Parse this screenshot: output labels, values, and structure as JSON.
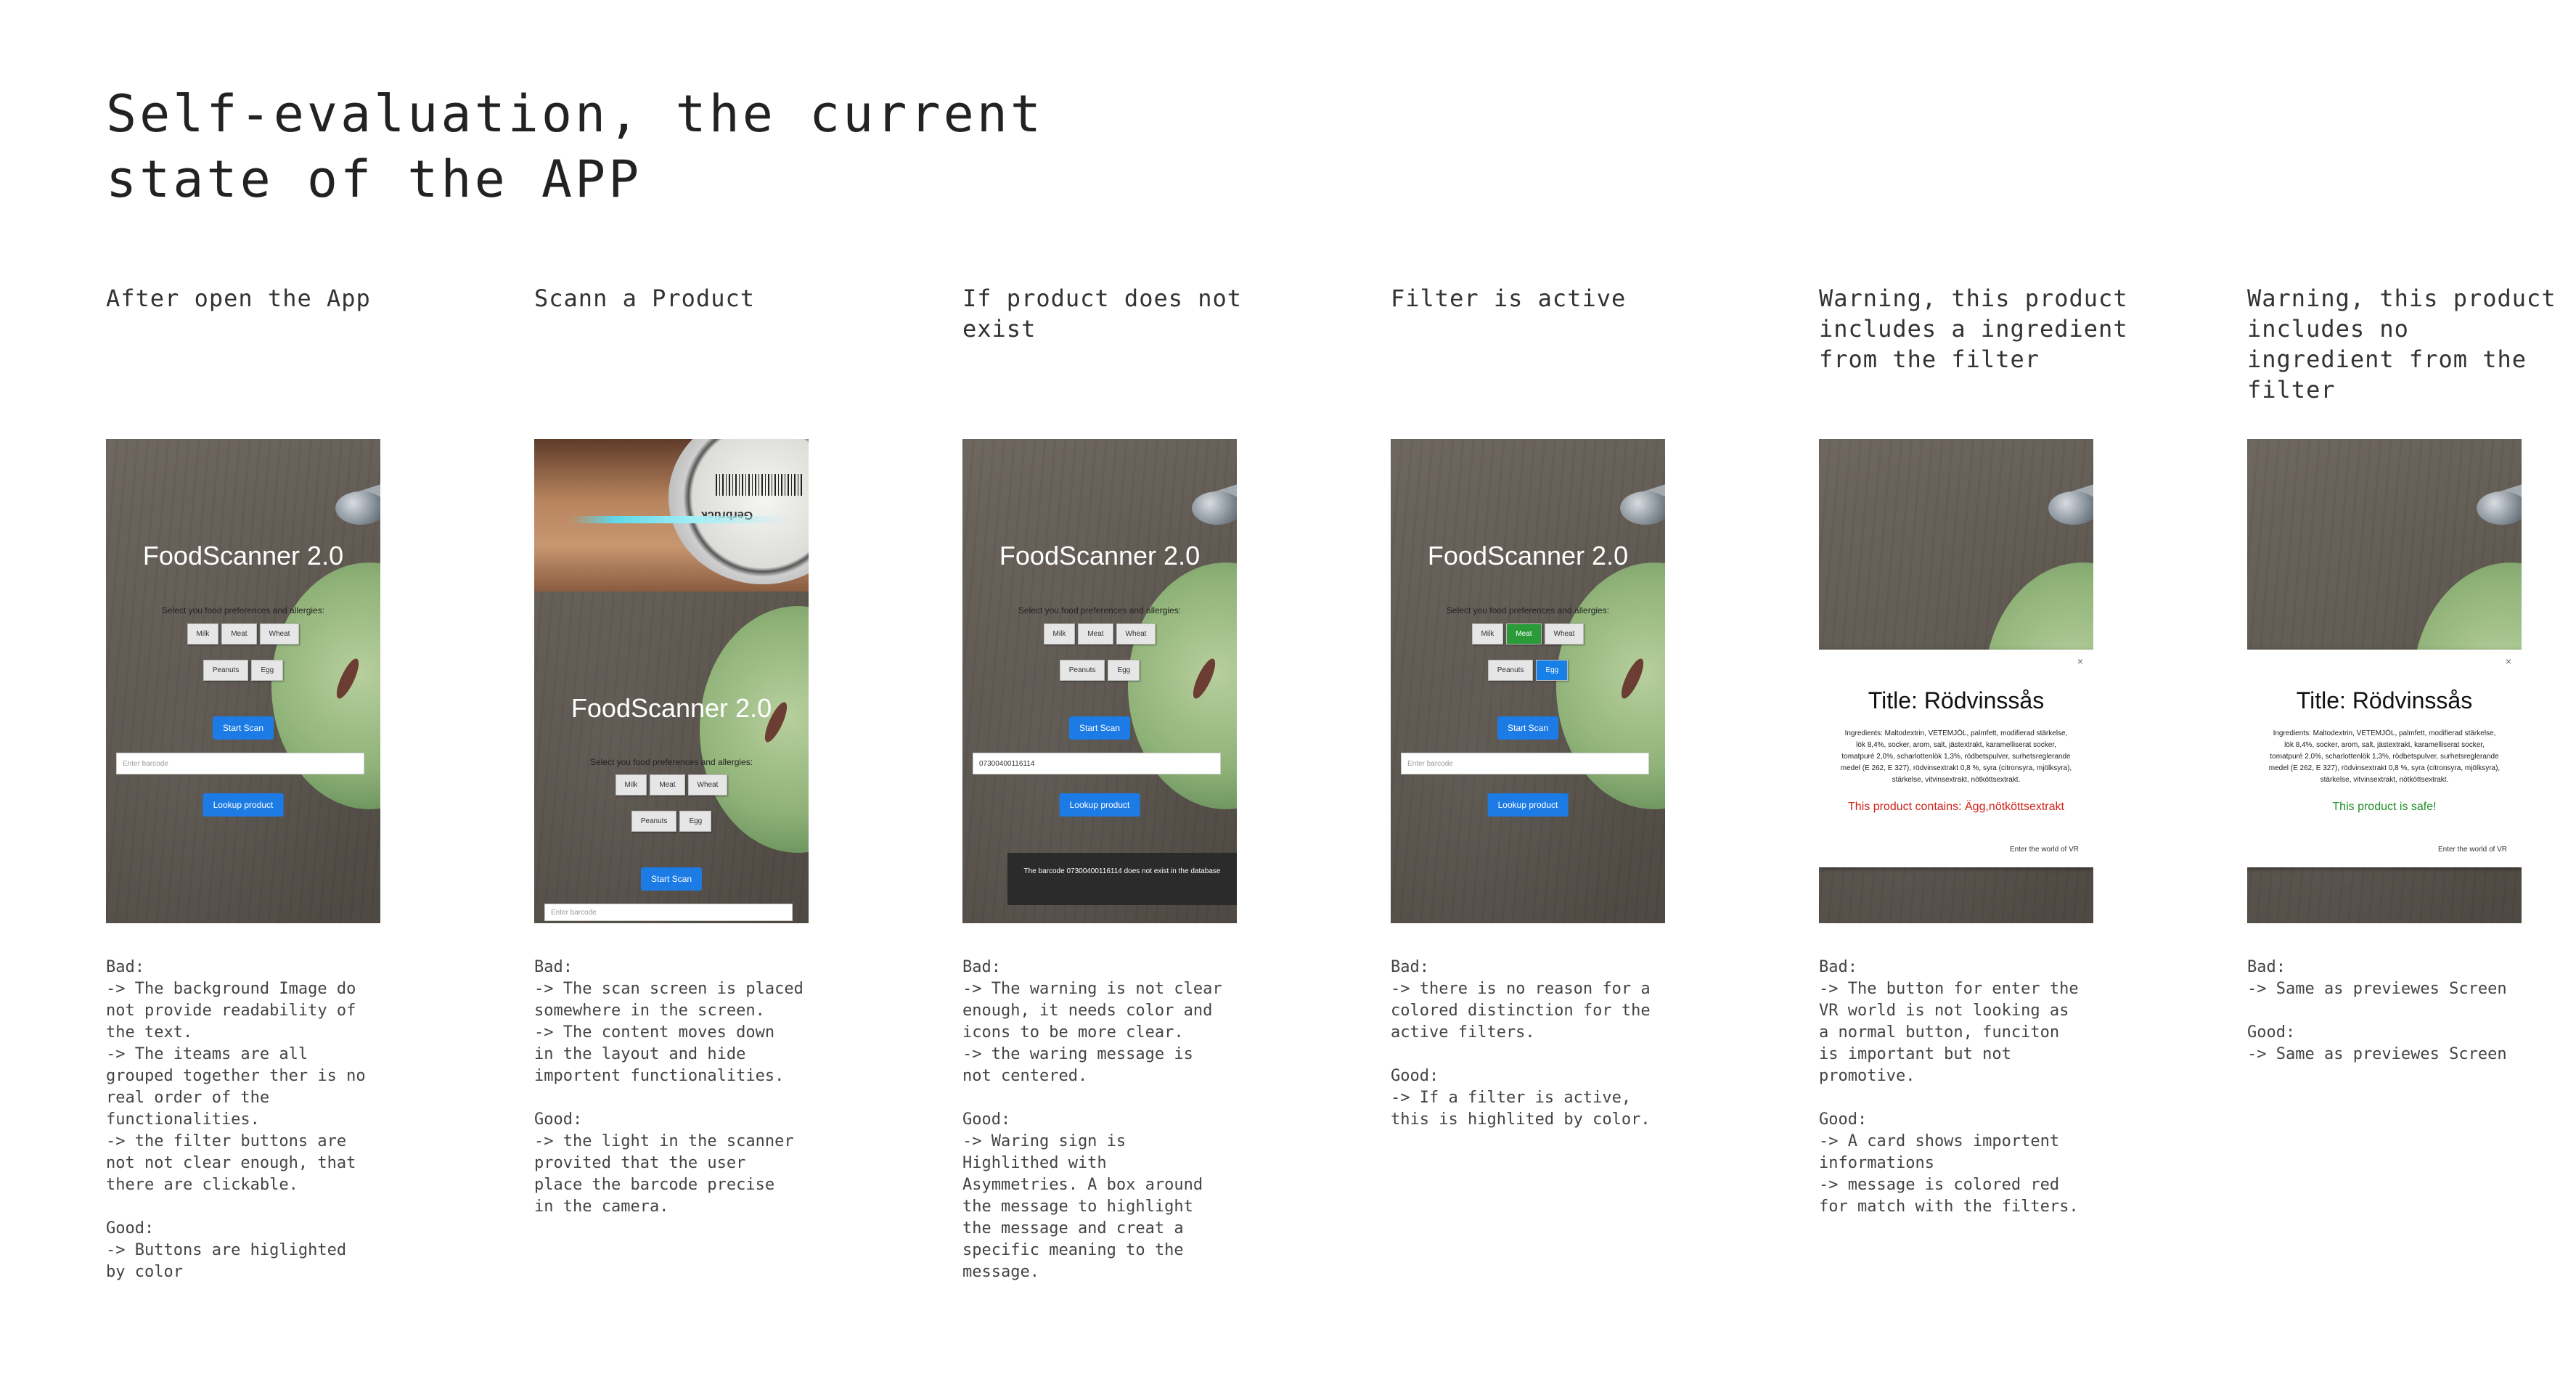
{
  "page_title": "Self-evaluation, the current\nstate of the APP",
  "app": {
    "name": "FoodScanner 2.0",
    "prefs_label": "Select you food preferences and allergies:",
    "chips_row1": [
      "Milk",
      "Meat",
      "Wheat"
    ],
    "chips_row2": [
      "Peanuts",
      "Egg"
    ],
    "start_scan": "Start Scan",
    "barcode_placeholder": "Enter barcode",
    "lookup": "Lookup product",
    "barcode_value": "07300400116114",
    "toast": "The barcode 07300400116114 does not exist in the database",
    "scan_lens_text": "Gerbrück",
    "modal": {
      "close": "×",
      "title": "Title: Rödvinssås",
      "ingredients": "Ingredients: Maltodextrin, VETEMJÖL, palmfett, modifierad stärkelse, lök 8,4%, socker, arom, salt, jästextrakt, karamelliserat socker, tomatpuré 2,0%, scharlottenlök 1,3%, rödbetspulver, surhetsreglerande medel (E 262, E 327), rödvinsextrakt 0,8 %, syra (citronsyra, mjölksyra), stärkelse, vitvinsextrakt, nötköttsextrakt.",
      "warning": "This product contains: Ägg,nötköttsextrakt",
      "safe": "This product is safe!",
      "vr": "Enter the world of VR"
    }
  },
  "columns": [
    {
      "heading": "After open the App",
      "notes": "Bad:\n-> The background Image do\nnot provide readability of\nthe text.\n-> The iteams are all\ngrouped together ther is no\nreal order of the\nfunctionalities.\n-> the filter buttons are\nnot not clear enough, that\nthere are clickable.\n\nGood:\n-> Buttons are higlighted\nby color"
    },
    {
      "heading": "Scann a Product",
      "notes": "Bad:\n-> The scan screen is placed\nsomewhere in the screen.\n-> The content moves down\nin the layout and hide\nimportent functionalities.\n\nGood:\n-> the light in the scanner\nprovited that the user\nplace the barcode precise\nin the camera."
    },
    {
      "heading": "If product does not\nexist",
      "notes": "Bad:\n-> The warning is not clear\nenough, it needs color and\nicons to be more clear.\n-> the waring message is\nnot centered.\n\nGood:\n-> Waring sign is\nHighlithed with\nAsymmetries. A box around\nthe message to highlight\nthe message and creat a\nspecific meaning to the\nmessage."
    },
    {
      "heading": "Filter is active",
      "notes": "Bad:\n-> there is no reason for a\ncolored distinction for the\nactive filters.\n\nGood:\n-> If a filter is active,\nthis is highlited by color."
    },
    {
      "heading": "Warning, this product\nincludes a ingredient\nfrom the filter",
      "notes": "Bad:\n-> The button for enter the\nVR world is not looking as\na normal button, funciton\nis important but not\npromotive.\n\nGood:\n-> A card shows importent\ninformations\n-> message is colored red\nfor match with the filters."
    },
    {
      "heading": "Warning, this product\nincludes no\ningredient from the\nfilter",
      "notes": "Bad:\n-> Same as previewes Screen\n\nGood:\n-> Same as previewes Screen"
    }
  ]
}
